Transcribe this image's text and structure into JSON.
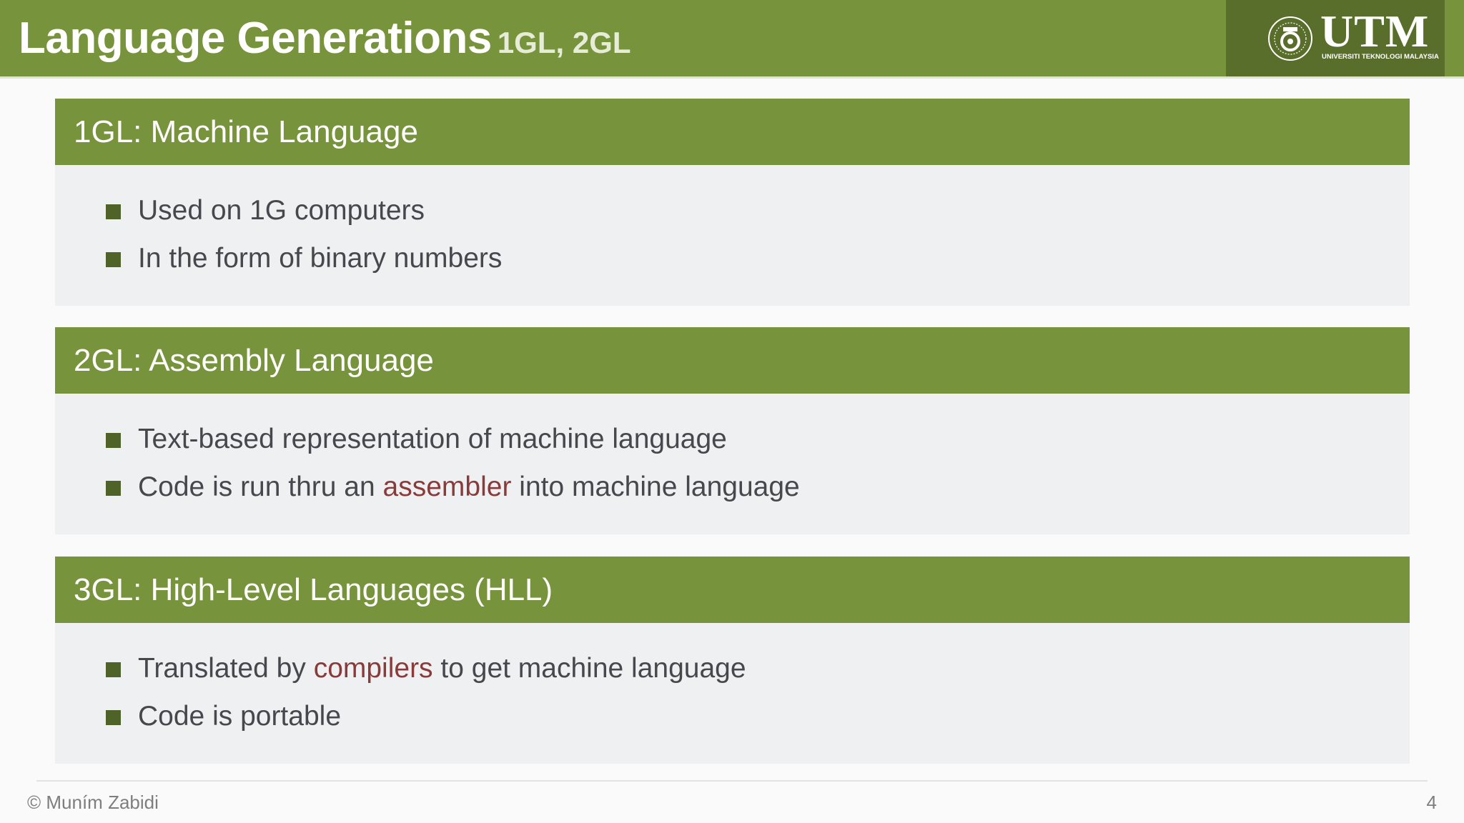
{
  "header": {
    "title": "Language Generations",
    "subtitle": "1GL, 2GL",
    "logo": {
      "name": "UTM",
      "caption": "UNIVERSITI TEKNOLOGI MALAYSIA"
    }
  },
  "sections": [
    {
      "heading": "1GL: Machine Language",
      "bullets": [
        {
          "parts": [
            "Used on 1G computers"
          ]
        },
        {
          "parts": [
            "In the form of binary numbers"
          ]
        }
      ]
    },
    {
      "heading": "2GL: Assembly Language",
      "bullets": [
        {
          "parts": [
            "Text-based representation of machine language"
          ]
        },
        {
          "parts": [
            "Code is run thru an ",
            "assembler",
            " into machine language"
          ]
        }
      ]
    },
    {
      "heading": "3GL: High-Level Languages (HLL)",
      "bullets": [
        {
          "parts": [
            "Translated by ",
            "compilers",
            " to get machine language"
          ]
        },
        {
          "parts": [
            "Code is portable"
          ]
        }
      ]
    }
  ],
  "footer": {
    "copyright": "© Muním Zabidi",
    "page_number": "4"
  },
  "colors": {
    "accent_green": "#77933c",
    "highlight_red": "#8b3a3a",
    "bullet_green": "#4f6228"
  }
}
